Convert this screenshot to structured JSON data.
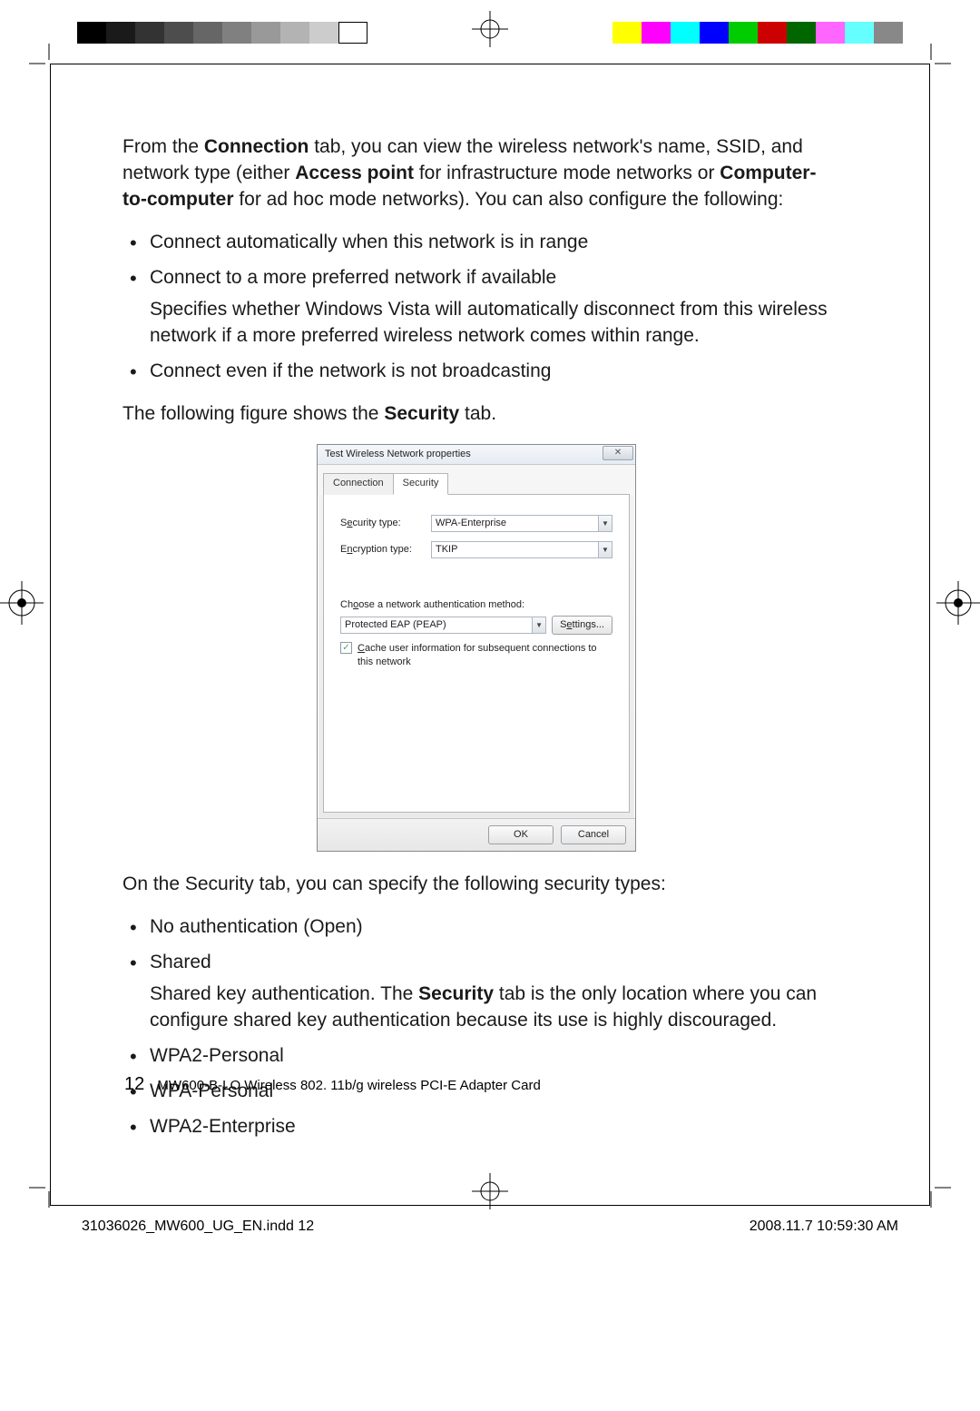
{
  "body": {
    "para1_pre": "From the ",
    "para1_b1": "Connection",
    "para1_mid1": " tab, you can view the wireless network's name, SSID, and network type (either ",
    "para1_b2": "Access point",
    "para1_mid2": " for infrastructure mode networks or ",
    "para1_b3": "Computer-to-computer",
    "para1_post": " for ad hoc mode networks). You can also configure the following:",
    "bullets1": {
      "0": "Connect automatically when this network is in range",
      "1": "Connect to a more preferred network if available",
      "1_sub": "Specifies whether Windows Vista will automatically disconnect from this wireless network if a more preferred wireless network comes within range.",
      "2": "Connect even if the network is not broadcasting"
    },
    "para2_pre": "The following figure shows the ",
    "para2_b": "Security",
    "para2_post": " tab.",
    "para3": "On the Security tab, you can specify the following security types:",
    "bullets2": {
      "0": "No authentication (Open)",
      "1": "Shared",
      "1_sub_pre": "Shared key authentication. The ",
      "1_sub_b": "Security",
      "1_sub_post": " tab is the only location where you can configure shared key authentication because its use is highly discouraged.",
      "2": "WPA2-Personal",
      "3": "WPA-Personal",
      "4": "WPA2-Enterprise"
    }
  },
  "dialog": {
    "title": "Test Wireless Network properties",
    "tab_connection": "Connection",
    "tab_security": "Security",
    "security_type_label": "Security type:",
    "security_type_value": "WPA-Enterprise",
    "encryption_type_label": "Encryption type:",
    "encryption_type_value": "TKIP",
    "auth_method_label": "Choose a network authentication method:",
    "auth_method_value": "Protected EAP (PEAP)",
    "settings_btn": "Settings...",
    "cache_checkbox": "Cache user information for subsequent connections to this network",
    "ok": "OK",
    "cancel": "Cancel"
  },
  "page_footer": {
    "num": "12",
    "title": "MW600-B-LO Wireless 802. 11b/g wireless PCI-E Adapter Card"
  },
  "proof_footer": {
    "file": "31036026_MW600_UG_EN.indd   12",
    "date": "2008.11.7   10:59:30 AM"
  }
}
